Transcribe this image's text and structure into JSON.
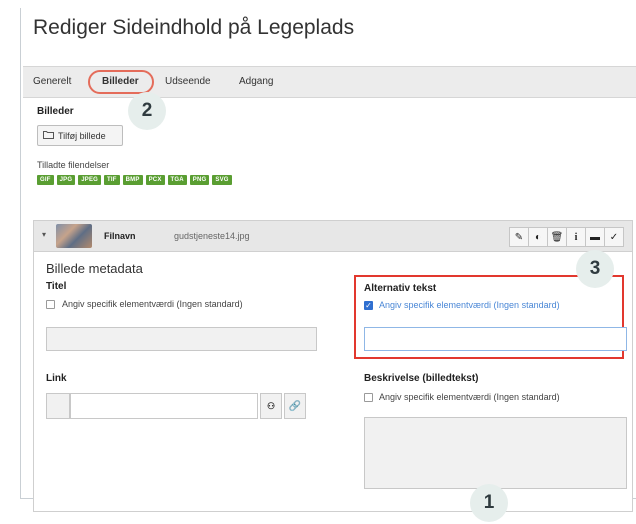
{
  "page": {
    "title": "Rediger Sideindhold på Legeplads"
  },
  "tabs": [
    {
      "label": "Generelt"
    },
    {
      "label": "Billeder"
    },
    {
      "label": "Udseende"
    },
    {
      "label": "Adgang"
    }
  ],
  "images_section": {
    "heading": "Billeder",
    "add_button": "Tilføj billede",
    "allowed_label": "Tilladte filendelser",
    "extensions": [
      "GIF",
      "JPG",
      "JPEG",
      "TIF",
      "BMP",
      "PCX",
      "TGA",
      "PNG",
      "SVG"
    ]
  },
  "file": {
    "name_label": "Filnavn",
    "filename": "gudstjeneste14.jpg"
  },
  "metadata": {
    "heading": "Billede metadata",
    "title_label": "Titel",
    "title_override": "Angiv specifik elementværdi (Ingen standard)",
    "alt_label": "Alternativ tekst",
    "alt_override": "Angiv specifik elementværdi (Ingen standard)",
    "link_label": "Link",
    "description_label": "Beskrivelse (billedtekst)",
    "description_override": "Angiv specifik elementværdi (Ingen standard)"
  },
  "steps": {
    "one": "1",
    "two": "2",
    "three": "3"
  },
  "icons": {
    "folder": "folder-icon",
    "collapse": "chevron-down-icon",
    "edit": "pencil-icon",
    "toggle": "toggle-icon",
    "delete": "trash-icon",
    "info": "info-icon",
    "hide": "dash-icon",
    "check": "check-icon",
    "browse": "link-browser-icon",
    "link": "link-icon"
  },
  "colors": {
    "tab_highlight": "#e46c5a",
    "alt_highlight": "#e2382e",
    "badge": "#5a9e32",
    "checkbox_checked": "#2f6fd0",
    "step_bg": "#e6eeec"
  }
}
